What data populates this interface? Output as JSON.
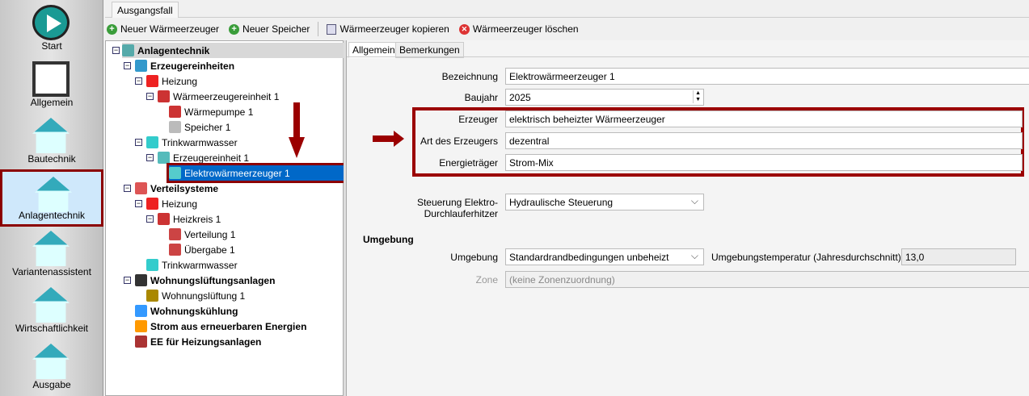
{
  "sidebar": {
    "items": [
      {
        "label": "Start",
        "icon": "play-icon"
      },
      {
        "label": "Allgemein",
        "icon": "notebook-icon"
      },
      {
        "label": "Bautechnik",
        "icon": "house-icon"
      },
      {
        "label": "Anlagentechnik",
        "icon": "house-solar-icon",
        "selected": true
      },
      {
        "label": "Variantenassistent",
        "icon": "wizard-house-icon"
      },
      {
        "label": "Wirtschaftlichkeit",
        "icon": "chart-house-icon"
      },
      {
        "label": "Ausgabe",
        "icon": "document-pen-icon"
      }
    ]
  },
  "case_tab": "Ausgangsfall",
  "toolbar": {
    "new_generator": "Neuer Wärmeerzeuger",
    "new_storage": "Neuer Speicher",
    "copy_generator": "Wärmeerzeuger kopieren",
    "delete_generator": "Wärmeerzeuger löschen"
  },
  "tree": [
    {
      "label": "Anlagentechnik",
      "level": 0,
      "bold": true,
      "exp": true,
      "color": "#5aa"
    },
    {
      "label": "Erzeugereinheiten",
      "level": 1,
      "bold": true,
      "exp": true,
      "color": "#39c"
    },
    {
      "label": "Heizung",
      "level": 2,
      "exp": true,
      "color": "#e22"
    },
    {
      "label": "Wärmeerzeugereinheit 1",
      "level": 3,
      "exp": true,
      "color": "#c33"
    },
    {
      "label": "Wärmepumpe 1",
      "level": 4,
      "color": "#c33"
    },
    {
      "label": "Speicher 1",
      "level": 4,
      "color": "#bbb"
    },
    {
      "label": "Trinkwarmwasser",
      "level": 2,
      "exp": true,
      "color": "#3cc"
    },
    {
      "label": "Erzeugereinheit 1",
      "level": 3,
      "exp": true,
      "color": "#5bb"
    },
    {
      "label": "Elektrowärmeerzeuger 1",
      "level": 4,
      "selected": true,
      "color": "#5cc"
    },
    {
      "label": "Verteilsysteme",
      "level": 1,
      "bold": true,
      "exp": true,
      "color": "#d55"
    },
    {
      "label": "Heizung",
      "level": 2,
      "exp": true,
      "color": "#e22"
    },
    {
      "label": "Heizkreis 1",
      "level": 3,
      "exp": true,
      "color": "#c33"
    },
    {
      "label": "Verteilung 1",
      "level": 4,
      "color": "#c44"
    },
    {
      "label": "Übergabe 1",
      "level": 4,
      "color": "#c44"
    },
    {
      "label": "Trinkwarmwasser",
      "level": 2,
      "color": "#3cc"
    },
    {
      "label": "Wohnungslüftungsanlagen",
      "level": 1,
      "bold": true,
      "exp": true,
      "color": "#333"
    },
    {
      "label": "Wohnungslüftung 1",
      "level": 2,
      "color": "#a80"
    },
    {
      "label": "Wohnungskühlung",
      "level": 1,
      "bold": true,
      "color": "#39f"
    },
    {
      "label": "Strom aus erneuerbaren Energien",
      "level": 1,
      "bold": true,
      "color": "#f90"
    },
    {
      "label": "EE für Heizungsanlagen",
      "level": 1,
      "bold": true,
      "color": "#a33"
    }
  ],
  "detail": {
    "tabs": [
      "Allgemein",
      "Bemerkungen"
    ],
    "fields": {
      "bezeichnung": {
        "label": "Bezeichnung",
        "value": "Elektrowärmeerzeuger 1"
      },
      "baujahr": {
        "label": "Baujahr",
        "value": "2025"
      },
      "erzeuger": {
        "label": "Erzeuger",
        "value": "elektrisch beheizter Wärmeerzeuger"
      },
      "art": {
        "label": "Art des Erzeugers",
        "value": "dezentral"
      },
      "energietraeger": {
        "label": "Energieträger",
        "value": "Strom-Mix"
      },
      "steuerung": {
        "label": "Steuerung Elektro-Durchlauferhitzer",
        "value": "Hydraulische Steuerung"
      }
    },
    "umgebung": {
      "heading": "Umgebung",
      "label": "Umgebung",
      "value": "Standardrandbedingungen unbeheizt",
      "temp_label": "Umgebungstemperatur (Jahresdurchschnitt) [°C]",
      "temp_value": "13,0",
      "zone_label": "Zone",
      "zone_value": "(keine Zonenzuordnung)"
    }
  },
  "colors": {
    "highlight": "#9b0000",
    "selection": "#0068c8"
  }
}
